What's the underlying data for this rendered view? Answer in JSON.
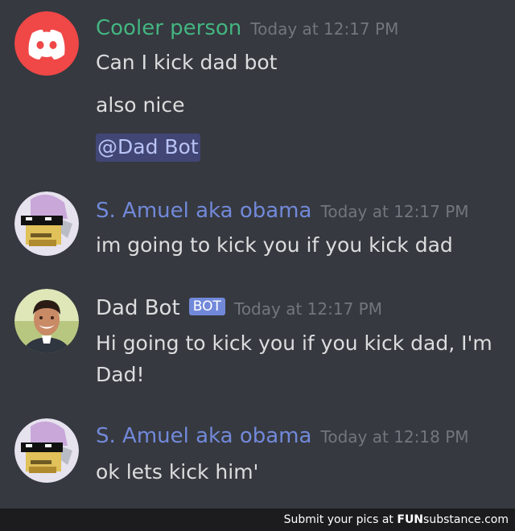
{
  "messages": [
    {
      "author": "Cooler person",
      "author_color": "#43b581",
      "timestamp": "Today at 12:17 PM",
      "lines": [
        "Can I kick dad bot",
        "also nice"
      ],
      "mention": "@Dad Bot",
      "avatar_icon": "discord-logo-icon"
    },
    {
      "author": "S. Amuel aka obama",
      "author_color": "#7289da",
      "timestamp": "Today at 12:17 PM",
      "lines": [
        "im going to kick you if you kick dad"
      ],
      "avatar_icon": "pixel-sunglasses-face-icon"
    },
    {
      "author": "Dad Bot",
      "author_color": "#dcddde",
      "bot_tag": "BOT",
      "timestamp": "Today at 12:17 PM",
      "lines": [
        "Hi going to kick you if you kick dad, I'm",
        "Dad!"
      ],
      "avatar_icon": "smiling-man-photo-icon"
    },
    {
      "author": "S. Amuel aka obama",
      "author_color": "#7289da",
      "timestamp": "Today at 12:18 PM",
      "lines": [
        "ok lets kick him'"
      ],
      "avatar_icon": "pixel-sunglasses-face-icon"
    }
  ],
  "footer": {
    "prefix": "Submit your pics at",
    "brand_fun": "FUN",
    "brand_sub": "substance",
    "brand_suffix": ".com"
  }
}
